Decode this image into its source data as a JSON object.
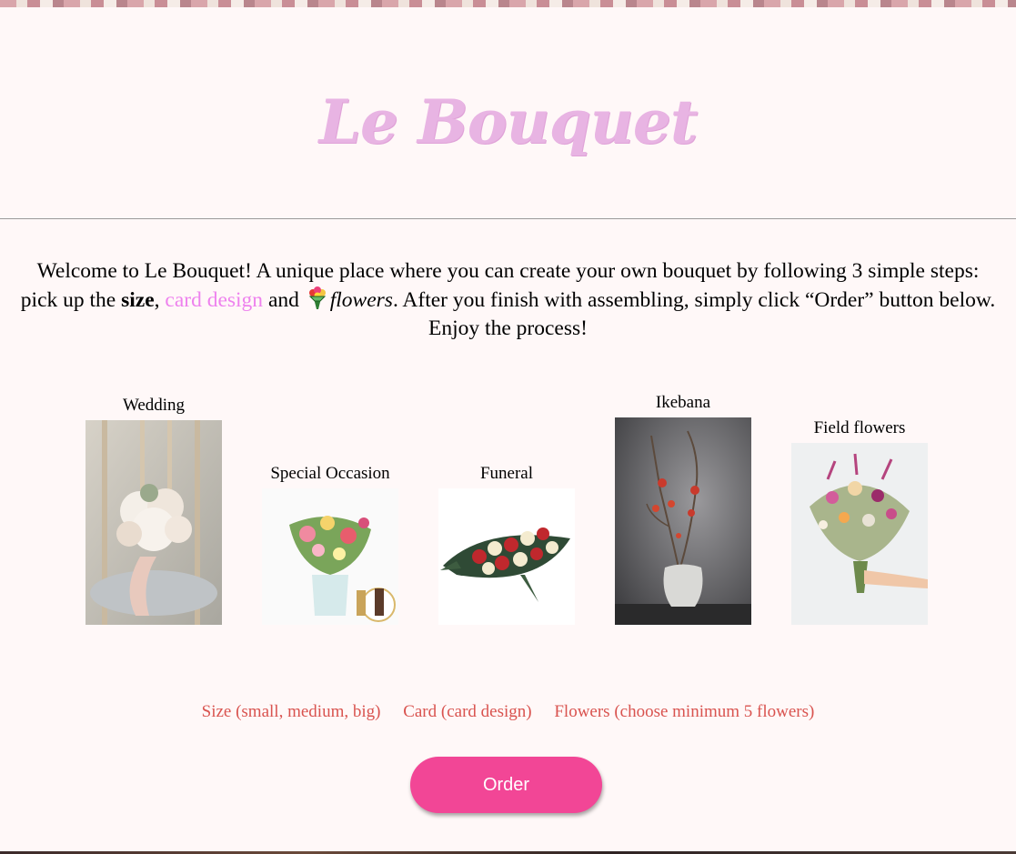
{
  "site": {
    "title": "Le Bouquet"
  },
  "intro": {
    "line1": "Welcome to Le Bouquet! A unique place where you can create your own bouquet by following 3 simple steps:",
    "pick_prefix": "pick up the ",
    "size_word": "size",
    "comma": ", ",
    "card_link": "card design",
    "and_word": " and ",
    "flowers_word": "flowers",
    "rest": ". After you finish with assembling, simply click “Order” button below. Enjoy the process!"
  },
  "categories": [
    {
      "label": "Wedding",
      "image": "white wedding bouquet on chair"
    },
    {
      "label": "Special Occasion",
      "image": "colorful bouquet in glass vase"
    },
    {
      "label": "Funeral",
      "image": "red and white roses spray"
    },
    {
      "label": "Ikebana",
      "image": "red blossom branch in white vase"
    },
    {
      "label": "Field flowers",
      "image": "wildflower bouquet held in hand"
    }
  ],
  "steps": {
    "size": "Size (small, medium, big)",
    "card": "Card (card design)",
    "flowers": "Flowers (choose minimum 5 flowers)"
  },
  "order": {
    "label": "Order",
    "color": "#f24696"
  },
  "colors": {
    "background": "#fff8f8",
    "title": "#e8b4e3",
    "card_link": "#ee82ee",
    "steps": "#d9534f"
  }
}
